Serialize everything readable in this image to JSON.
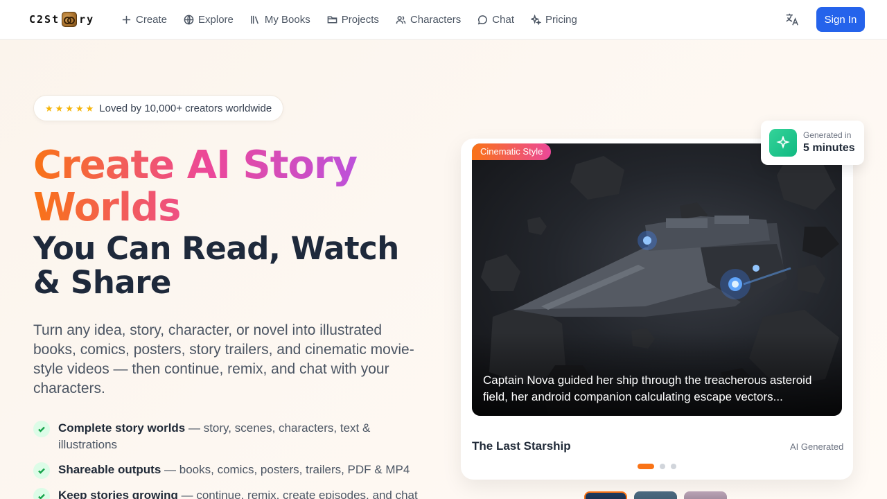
{
  "nav": {
    "logo_left": "C2St",
    "logo_right": "ry",
    "links": [
      {
        "label": "Create",
        "icon": "plus-icon"
      },
      {
        "label": "Explore",
        "icon": "globe-icon"
      },
      {
        "label": "My Books",
        "icon": "books-icon"
      },
      {
        "label": "Projects",
        "icon": "folder-icon"
      },
      {
        "label": "Characters",
        "icon": "users-icon"
      },
      {
        "label": "Chat",
        "icon": "chat-bubble-icon"
      },
      {
        "label": "Pricing",
        "icon": "sparkles-icon"
      }
    ],
    "translate_icon": "translate-icon",
    "signin_label": "Sign In"
  },
  "hero": {
    "rating_stars": 5,
    "social_proof": "Loved by 10,000+ creators worldwide",
    "headline_gradient": "Create AI Story Worlds",
    "headline_dark": "You Can Read, Watch & Share",
    "lead": "Turn any idea, story, character, or novel into illustrated books, comics, posters, story trailers, and cinematic movie-style videos — then continue, remix, and chat with your characters.",
    "features": [
      {
        "title": "Complete story worlds",
        "text": " — story, scenes, characters, text & illustrations"
      },
      {
        "title": "Shareable outputs",
        "text": " — books, comics, posters, trailers, PDF & MP4"
      },
      {
        "title": "Keep stories growing",
        "text": " — continue, remix, create episodes, and chat"
      }
    ]
  },
  "showcase": {
    "style_tag": "Cinematic Style",
    "generated_label": "Generated in",
    "generated_value": "5 minutes",
    "caption": "Captain Nova guided her ship through the treacherous asteroid field, her android companion calculating escape vectors...",
    "title": "The Last Starship",
    "badge": "AI Generated",
    "slides_count": 3,
    "active_slide": 0
  },
  "colors": {
    "accent_blue": "#2563eb",
    "gradient_start": "#f97316",
    "gradient_mid": "#ec4899",
    "gradient_end": "#a855f7",
    "check_green": "#16a34a"
  }
}
